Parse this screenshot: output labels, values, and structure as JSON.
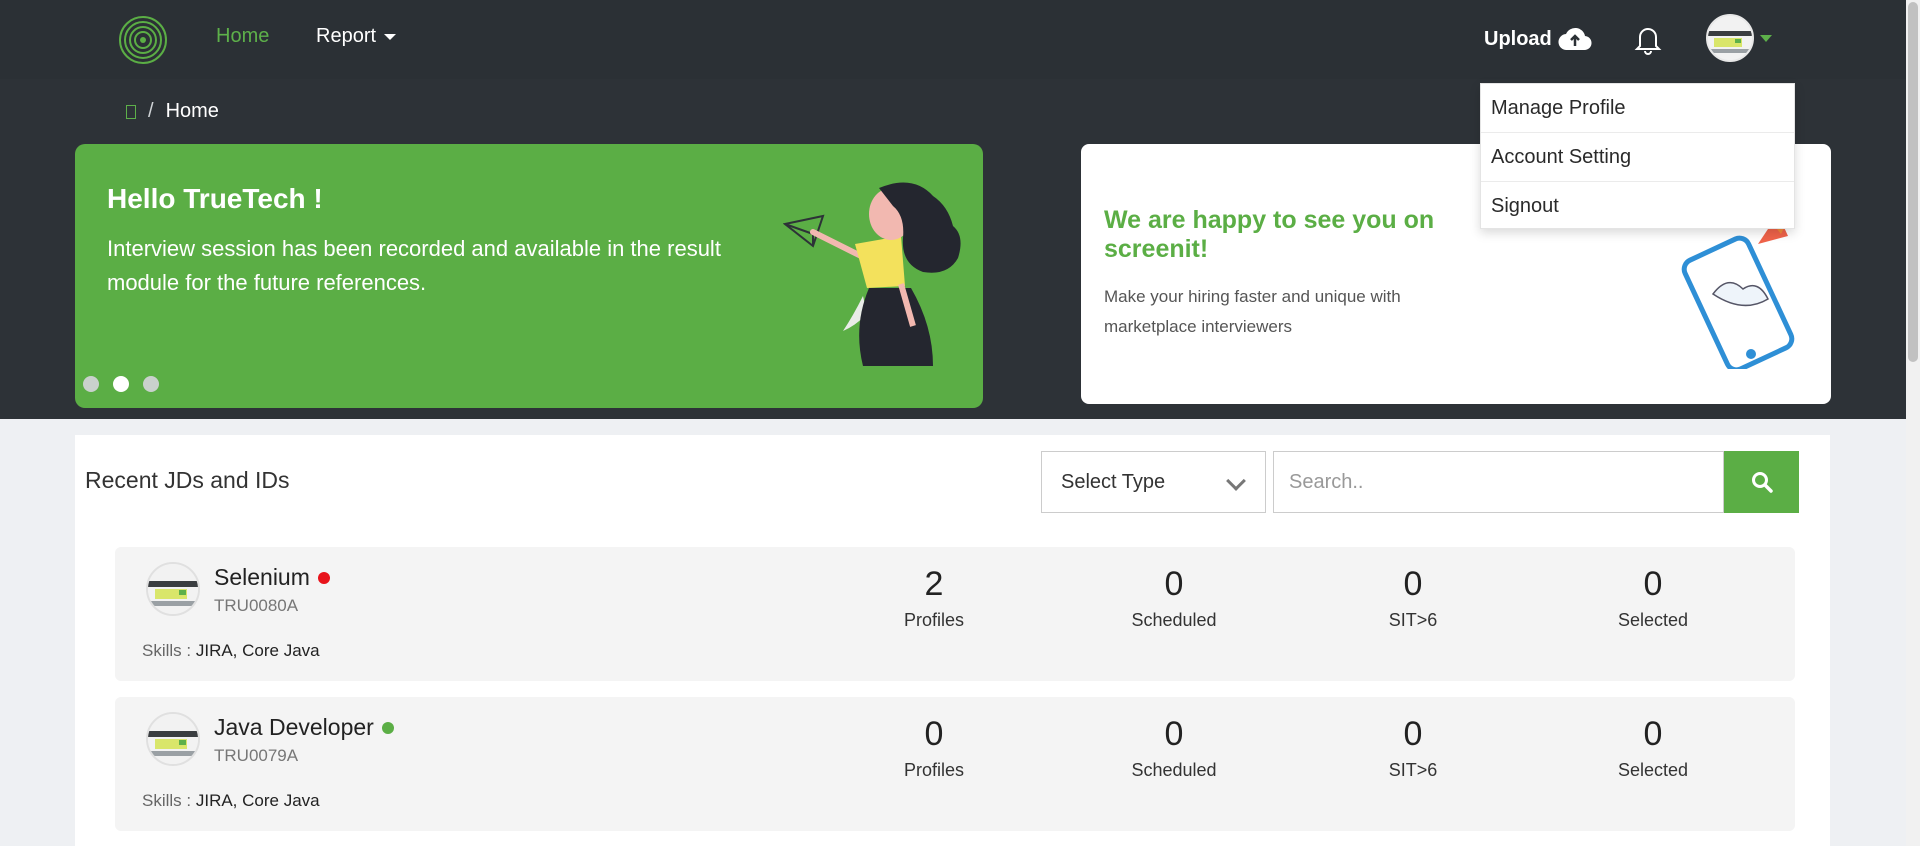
{
  "nav": {
    "home": "Home",
    "report": "Report",
    "upload": "Upload"
  },
  "breadcrumb": {
    "current": "Home",
    "separator": "/"
  },
  "hero": {
    "title": "Hello TrueTech !",
    "text": "Interview session has been recorded and available in the result module for the future references.",
    "active_slide": 2,
    "slide_count": 3
  },
  "welcome": {
    "title": "We are happy to see you on screenit!",
    "text": "Make your hiring faster and unique with marketplace interviewers"
  },
  "profile_menu": {
    "items": [
      "Manage Profile",
      "Account Setting",
      "Signout"
    ]
  },
  "panel": {
    "title": "Recent JDs and IDs",
    "select_label": "Select Type",
    "search_placeholder": "Search.."
  },
  "jobs": [
    {
      "title": "Selenium",
      "status_color": "#e8131b",
      "code": "TRU0080A",
      "skills_label": "Skills : ",
      "skills": "JIRA, Core Java",
      "stats": [
        {
          "value": "2",
          "label": "Profiles"
        },
        {
          "value": "0",
          "label": "Scheduled"
        },
        {
          "value": "0",
          "label": "SIT>6"
        },
        {
          "value": "0",
          "label": "Selected"
        }
      ]
    },
    {
      "title": "Java Developer",
      "status_color": "#5bae45",
      "code": "TRU0079A",
      "skills_label": "Skills : ",
      "skills": "JIRA, Core Java",
      "stats": [
        {
          "value": "0",
          "label": "Profiles"
        },
        {
          "value": "0",
          "label": "Scheduled"
        },
        {
          "value": "0",
          "label": "SIT>6"
        },
        {
          "value": "0",
          "label": "Selected"
        }
      ]
    }
  ],
  "colors": {
    "brand_green": "#5bae45",
    "dark_header": "#2d3237"
  }
}
